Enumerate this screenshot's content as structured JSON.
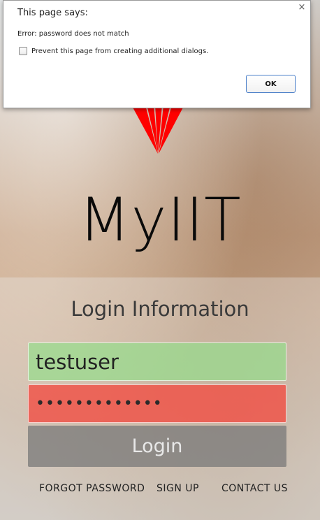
{
  "dialog": {
    "title": "This page says:",
    "message": "Error: password does not match",
    "checkbox_label": "Prevent this page from creating additional dialogs.",
    "checkbox_checked": false,
    "ok_label": "OK",
    "close_glyph": "×"
  },
  "app": {
    "title": "MyIIT",
    "logo_color": "#ff0000"
  },
  "form": {
    "heading": "Login Information",
    "username_value": "testuser",
    "password_masked": "•••••••••••••",
    "username_status_color": "#96dc8c",
    "password_status_color": "#f05046",
    "login_label": "Login"
  },
  "footer": {
    "forgot_password": "FORGOT PASSWORD",
    "sign_up": "SIGN UP",
    "contact_us": "CONTACT US"
  }
}
